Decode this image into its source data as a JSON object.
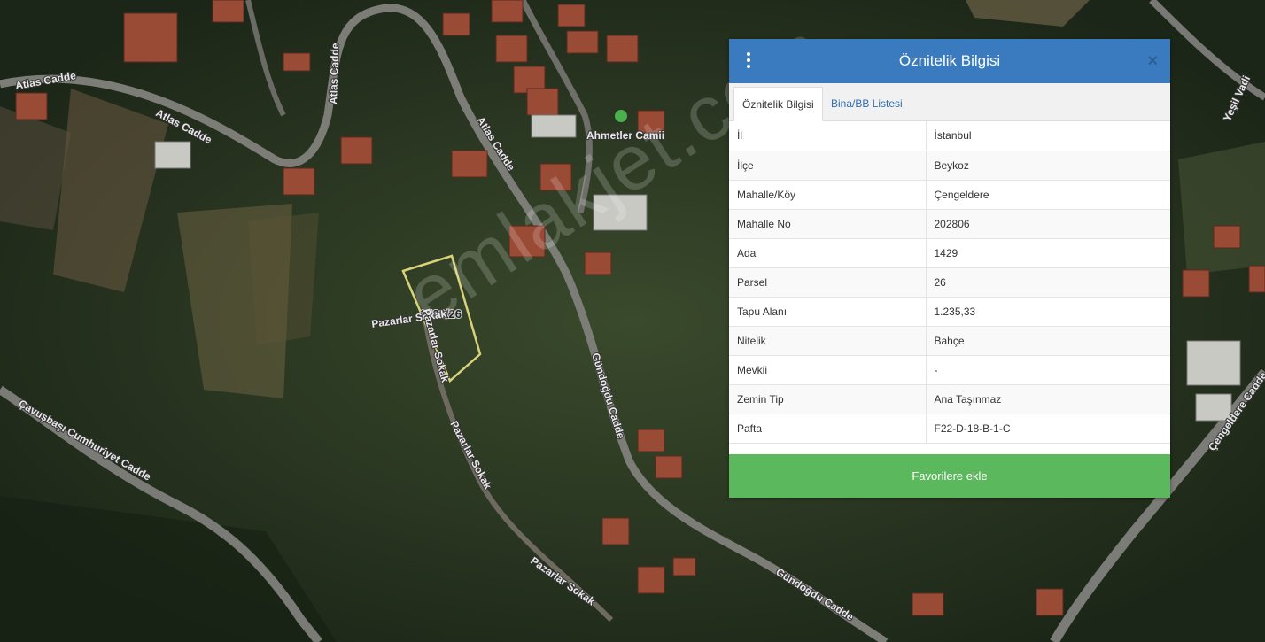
{
  "map": {
    "roads": [
      "Atlas Cadde",
      "Atlas Cadde",
      "Atlas Cadde",
      "Atlas Cadde",
      "Pazarlar Sokak",
      "Pazarlar Sokak",
      "Pazarlar Sokak",
      "Gündoğdu Cadde",
      "Gündoğdu Cadde",
      "Çavuşbaşı Cumhuriyet Cadde",
      "Çengeldere Cadde",
      "Yeşil Vadi",
      "Ahmetler Camii"
    ],
    "parcel_label": "1429/26",
    "watermark": "emlakjet.com",
    "parcel_color": "#d8d27a"
  },
  "panel": {
    "title": "Öznitelik Bilgisi",
    "close_symbol": "×",
    "tabs": [
      {
        "label": "Öznitelik Bilgisi",
        "active": true
      },
      {
        "label": "Bina/BB Listesi",
        "active": false
      }
    ],
    "rows": [
      {
        "key": "İl",
        "value": "İstanbul"
      },
      {
        "key": "İlçe",
        "value": "Beykoz"
      },
      {
        "key": "Mahalle/Köy",
        "value": "Çengeldere"
      },
      {
        "key": "Mahalle No",
        "value": "202806"
      },
      {
        "key": "Ada",
        "value": "1429"
      },
      {
        "key": "Parsel",
        "value": "26"
      },
      {
        "key": "Tapu Alanı",
        "value": "1.235,33"
      },
      {
        "key": "Nitelik",
        "value": "Bahçe"
      },
      {
        "key": "Mevkii",
        "value": "-"
      },
      {
        "key": "Zemin Tip",
        "value": "Ana Taşınmaz"
      },
      {
        "key": "Pafta",
        "value": "F22-D-18-B-1-C"
      }
    ],
    "favorite_label": "Favorilere ekle",
    "header_color": "#3a7bbf",
    "button_color": "#5cb85c"
  }
}
